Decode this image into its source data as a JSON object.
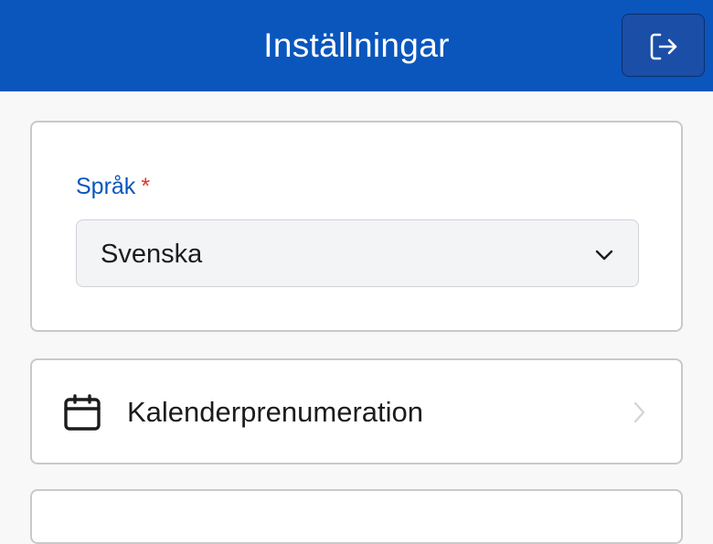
{
  "header": {
    "title": "Inställningar",
    "logout_icon": "logout-icon",
    "color": "#0a56bd"
  },
  "language_section": {
    "label": "Språk",
    "required_marker": "*",
    "selected_value": "Svenska",
    "dropdown_icon": "chevron-down-icon",
    "label_color": "#0a56bd",
    "required_color": "#e0342b"
  },
  "calendar_item": {
    "label": "Kalenderprenumeration",
    "icon": "calendar-icon",
    "chevron_icon": "chevron-right-icon"
  }
}
